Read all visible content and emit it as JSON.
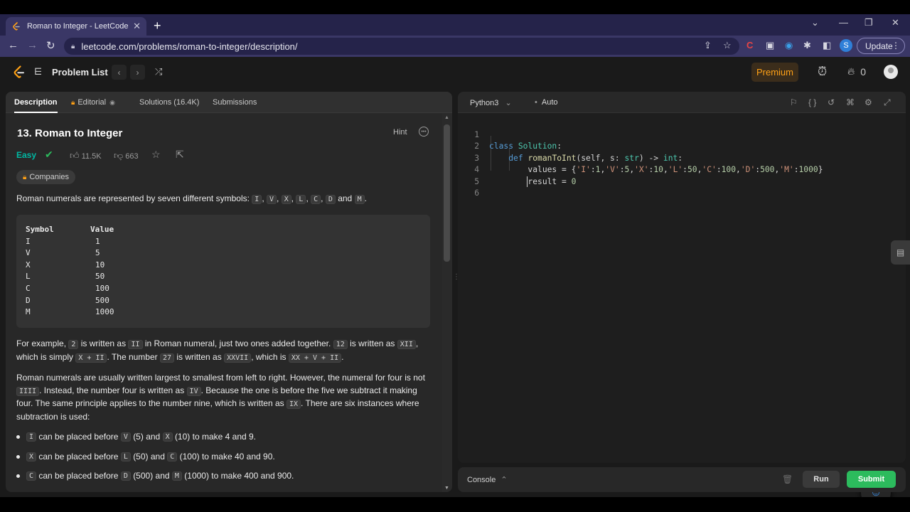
{
  "browser": {
    "tab_title": "Roman to Integer - LeetCode",
    "url": "leetcode.com/problems/roman-to-integer/description/",
    "update_label": "Update",
    "profile_initial": "S"
  },
  "nav": {
    "problem_list": "Problem List",
    "premium": "Premium",
    "streak_count": "0"
  },
  "left_tabs": {
    "description": "Description",
    "editorial": "Editorial",
    "solutions": "Solutions (16.4K)",
    "submissions": "Submissions"
  },
  "problem": {
    "title": "13. Roman to Integer",
    "hint": "Hint",
    "difficulty": "Easy",
    "likes": "11.5K",
    "dislikes": "663",
    "companies": "Companies",
    "intro_text": "Roman numerals are represented by seven different symbols:",
    "intro_and": "and",
    "symbols": [
      "I",
      "V",
      "X",
      "L",
      "C",
      "D",
      "M"
    ],
    "table_header": [
      "Symbol",
      "Value"
    ],
    "table_rows": [
      [
        "I",
        "1"
      ],
      [
        "V",
        "5"
      ],
      [
        "X",
        "10"
      ],
      [
        "L",
        "50"
      ],
      [
        "C",
        "100"
      ],
      [
        "D",
        "500"
      ],
      [
        "M",
        "1000"
      ]
    ],
    "example": {
      "t1": "For example,",
      "c1": "2",
      "t2": "is written as",
      "c2": "II",
      "t3": "in Roman numeral, just two ones added together.",
      "c3": "12",
      "t4": "is written as",
      "c4": "XII",
      "t5": ", which is simply",
      "c5": "X + II",
      "t6": ". The number",
      "c6": "27",
      "t7": "is written as",
      "c7": "XXVII",
      "t8": ", which is",
      "c8": "XX + V + II",
      "t9": "."
    },
    "subtraction": {
      "t1": "Roman numerals are usually written largest to smallest from left to right. However, the numeral for four is not",
      "c1": "IIII",
      "t2": ". Instead, the number four is written as",
      "c2": "IV",
      "t3": ". Because the one is before the five we subtract it making four. The same principle applies to the number nine, which is written as",
      "c3": "IX",
      "t4": ". There are six instances where subtraction is used:"
    },
    "bullets": [
      {
        "a": "I",
        "t1": "can be placed before",
        "b": "V",
        "t2": "(5) and",
        "c": "X",
        "t3": "(10) to make 4 and 9."
      },
      {
        "a": "X",
        "t1": "can be placed before",
        "b": "L",
        "t2": "(50) and",
        "c": "C",
        "t3": "(100) to make 40 and 90."
      },
      {
        "a": "C",
        "t1": "can be placed before",
        "b": "D",
        "t2": "(500) and",
        "c": "M",
        "t3": "(1000) to make 400 and 900."
      }
    ]
  },
  "editor": {
    "language": "Python3",
    "mode": "Auto",
    "line_numbers": [
      "1",
      "2",
      "3",
      "4",
      "5",
      "6"
    ]
  },
  "console": {
    "label": "Console",
    "run": "Run",
    "submit": "Submit"
  },
  "colors": {
    "accent_orange": "#ffa116",
    "easy_teal": "#00b8a3",
    "submit_green": "#2cbb5d"
  }
}
